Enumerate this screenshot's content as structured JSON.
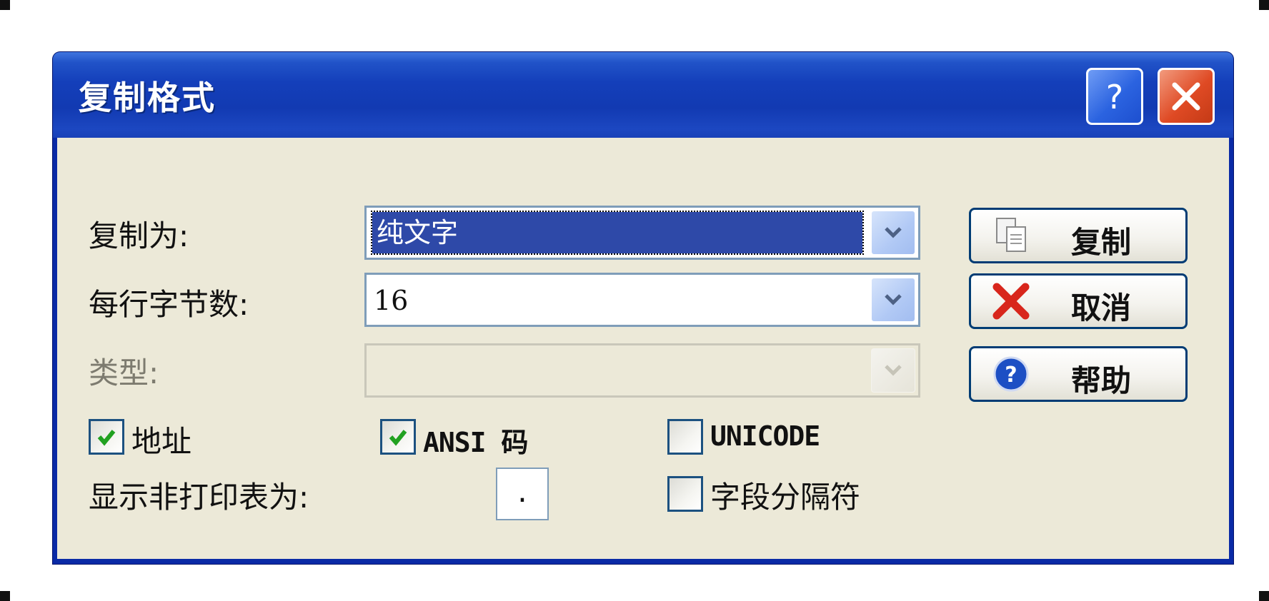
{
  "window": {
    "title": "复制格式"
  },
  "form": {
    "copy_as_label": "复制为:",
    "copy_as_value": "纯文字",
    "bytes_per_line_label": "每行字节数:",
    "bytes_per_line_value": "16",
    "type_label": "类型:",
    "type_value": "",
    "show_nonprintable_label": "显示非打印表为:",
    "nonprintable_char": "."
  },
  "checkboxes": [
    {
      "label": "地址",
      "checked": true
    },
    {
      "label": "ANSI 码",
      "checked": true
    },
    {
      "label": "UNICODE",
      "checked": false
    },
    {
      "label": "字段分隔符",
      "checked": false
    }
  ],
  "buttons": {
    "copy": "复制",
    "cancel": "取消",
    "help": "帮助"
  },
  "colors": {
    "title_bar": "#143fba",
    "dialog_bg": "#ece9d8",
    "selection": "#2e49a8",
    "check_green": "#21a121",
    "close_red": "#df4a24"
  },
  "icons": {
    "title_help": "help-icon",
    "title_close": "close-icon",
    "copy_button": "copy-icon",
    "cancel_button": "cancel-x-icon",
    "help_button": "help-circle-icon",
    "dropdown": "chevron-down-icon"
  }
}
